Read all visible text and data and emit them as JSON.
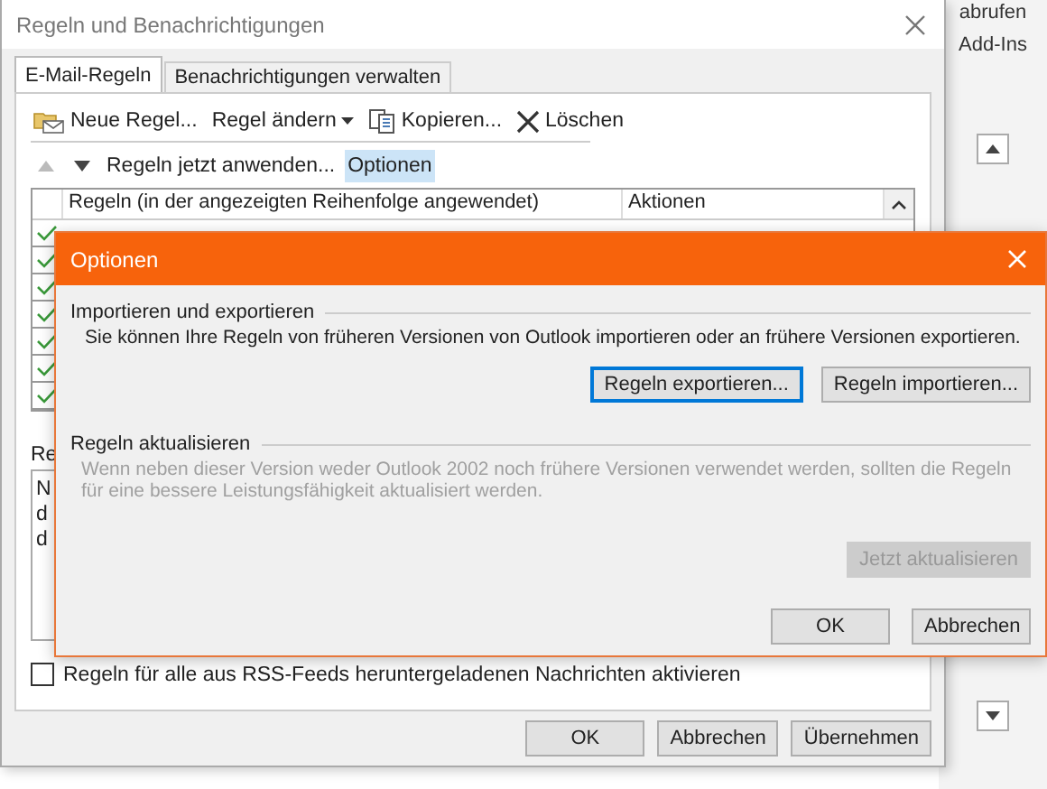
{
  "background_app": {
    "ribbon_labels": [
      "abrufen",
      "Add-Ins"
    ]
  },
  "main_dialog": {
    "title": "Regeln und Benachrichtigungen",
    "tabs": [
      {
        "label": "E-Mail-Regeln",
        "selected": true
      },
      {
        "label": "Benachrichtigungen verwalten",
        "selected": false
      }
    ],
    "toolbar": [
      {
        "kind": "new",
        "label": "Neue Regel..."
      },
      {
        "kind": "menu",
        "label": "Regel ändern"
      },
      {
        "kind": "copy",
        "label": "Kopieren..."
      },
      {
        "kind": "delete",
        "label": "Löschen"
      }
    ],
    "move_buttons": [
      {
        "kind": "up",
        "disabled": true
      },
      {
        "kind": "down",
        "disabled": false
      }
    ],
    "actions": [
      {
        "label": "Regeln jetzt anwenden...",
        "selected": false
      },
      {
        "label": "Optionen",
        "selected": true
      }
    ],
    "rules_table": {
      "columns": [
        "Regeln (in der angezeigten Reihenfolge angewendet)",
        "Aktionen"
      ],
      "rows": [
        {
          "checked": true
        },
        {
          "checked": true
        },
        {
          "checked": true
        },
        {
          "checked": true
        },
        {
          "checked": true
        },
        {
          "checked": true
        },
        {
          "checked": true
        }
      ]
    },
    "description_label": "Re",
    "description_lines": [
      "N",
      "d",
      "d"
    ],
    "rss_option": {
      "label": "Regeln für alle aus RSS-Feeds heruntergeladenen Nachrichten aktivieren",
      "checked": false
    },
    "buttons": [
      "OK",
      "Abbrechen",
      "Übernehmen"
    ]
  },
  "options_dialog": {
    "title": "Optionen",
    "sections": [
      {
        "heading": "Importieren und exportieren",
        "text": "Sie können Ihre Regeln von früheren Versionen von Outlook importieren oder an frühere Versionen exportieren.",
        "disabled": false,
        "buttons": [
          {
            "label": "Regeln exportieren...",
            "focused": true,
            "disabled": false
          },
          {
            "label": "Regeln importieren...",
            "focused": false,
            "disabled": false
          }
        ]
      },
      {
        "heading": "Regeln aktualisieren",
        "text": "Wenn neben dieser Version weder Outlook 2002 noch frühere Versionen verwendet werden, sollten die Regeln für eine bessere Leistungsfähigkeit aktualisiert werden.",
        "disabled": true,
        "buttons": [
          {
            "label": "Jetzt aktualisieren",
            "focused": false,
            "disabled": true
          }
        ]
      }
    ],
    "buttons": [
      "OK",
      "Abbrechen"
    ]
  }
}
